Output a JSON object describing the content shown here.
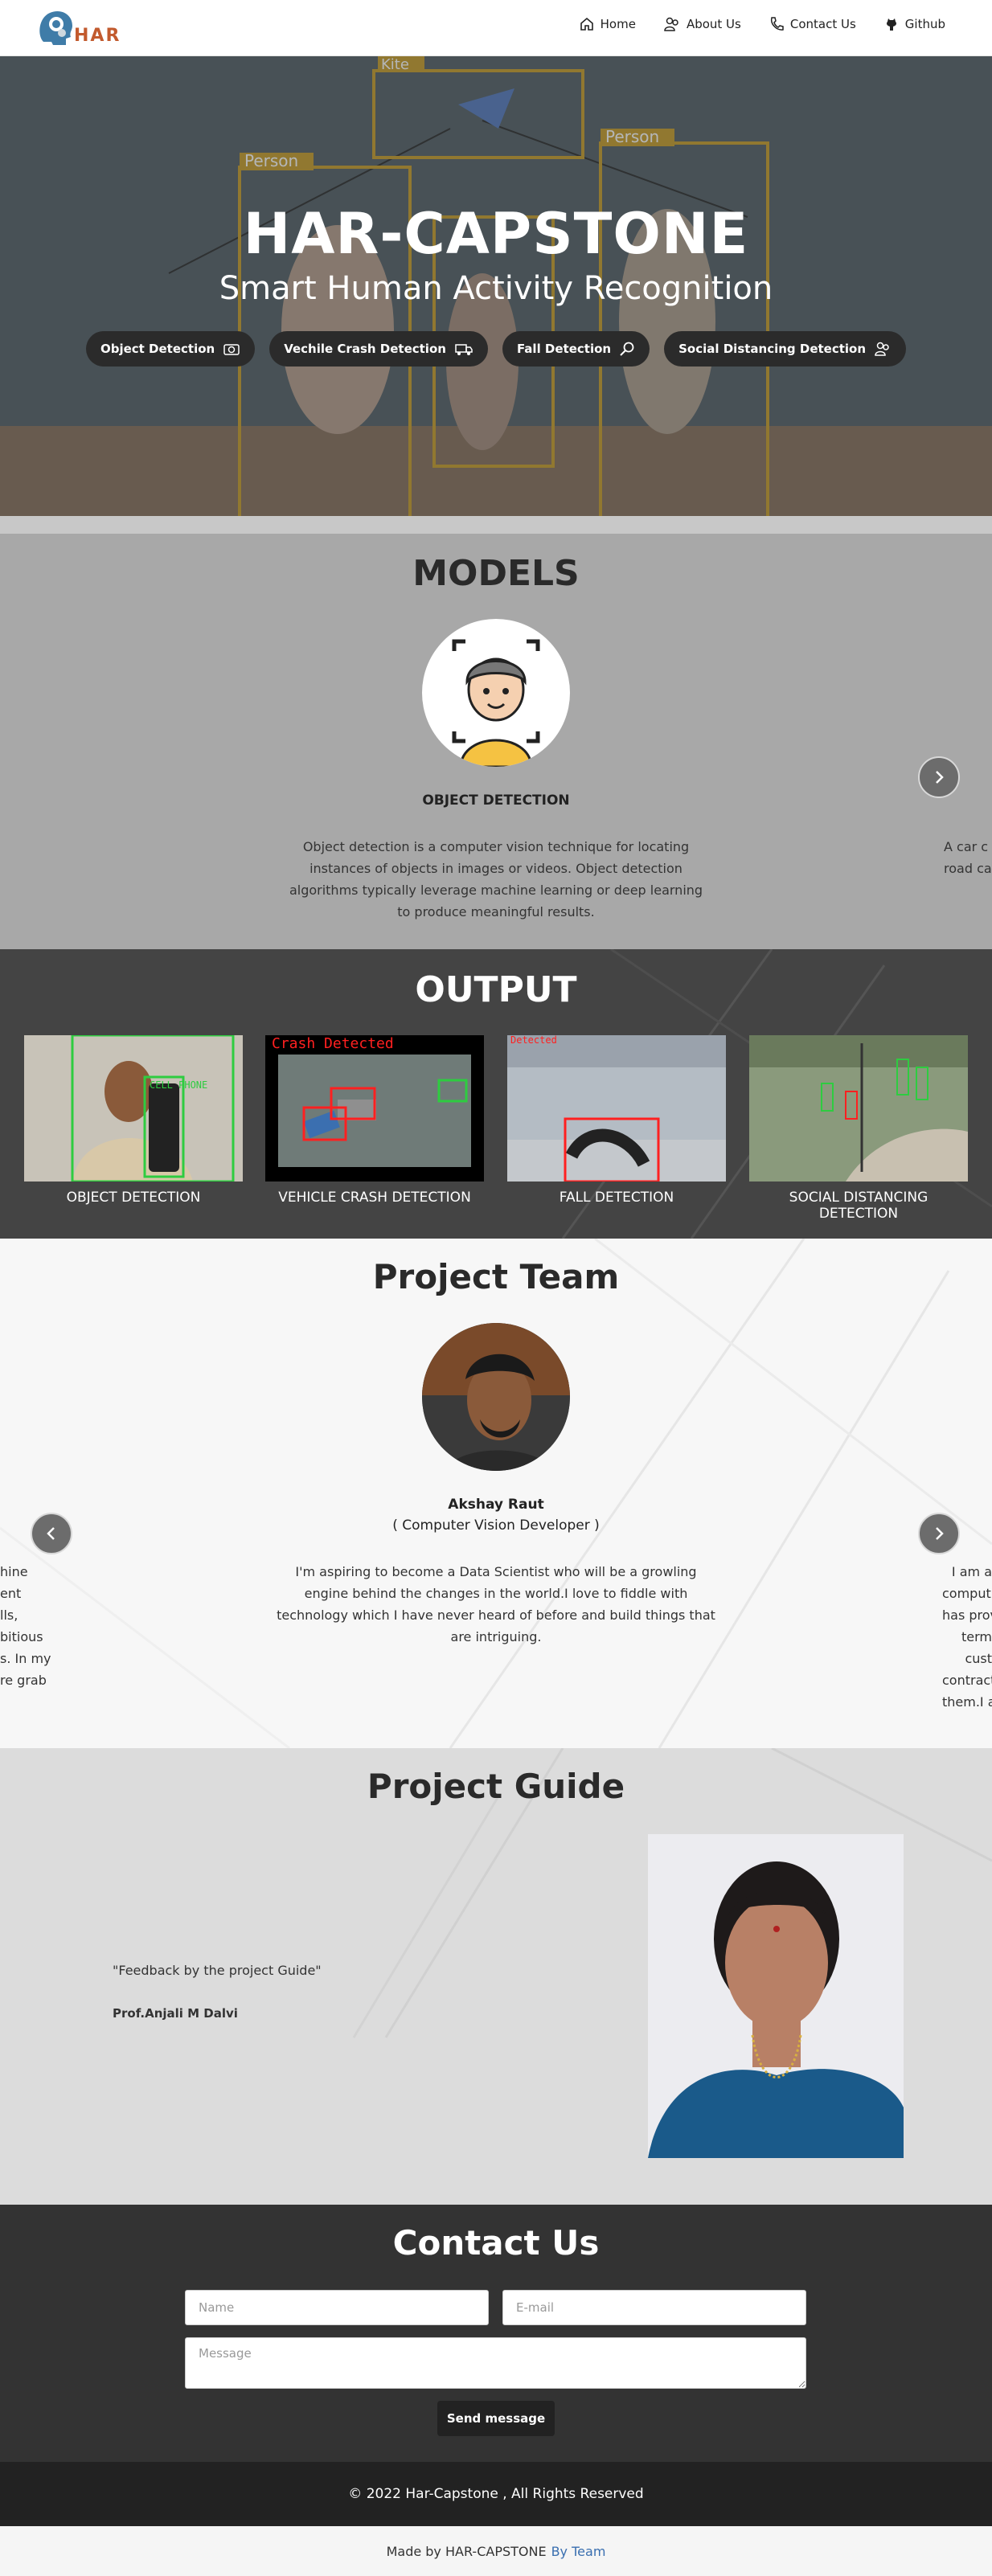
{
  "nav": {
    "logo_text": "HAR",
    "links": [
      {
        "label": "Home",
        "icon": "home-icon"
      },
      {
        "label": "About Us",
        "icon": "users-icon"
      },
      {
        "label": "Contact Us",
        "icon": "phone-icon"
      },
      {
        "label": "Github",
        "icon": "github-icon"
      }
    ]
  },
  "hero": {
    "title": "HAR-CAPSTONE",
    "subtitle": "Smart Human Activity Recognition",
    "box_labels": [
      "Kite",
      "Person",
      "Person"
    ],
    "pills": [
      {
        "label": "Object Detection",
        "icon": "camera-icon"
      },
      {
        "label": "Vechile Crash Detection",
        "icon": "truck-icon"
      },
      {
        "label": "Fall Detection",
        "icon": "search-icon"
      },
      {
        "label": "Social Distancing Detection",
        "icon": "people-icon"
      }
    ]
  },
  "models": {
    "title": "MODELS",
    "current": {
      "name": "OBJECT DETECTION",
      "description": "Object detection is a computer vision technique for locating instances of objects in images or videos. Object detection algorithms typically leverage machine learning or deep learning to produce meaningful results."
    },
    "next_peek": "A car c\nroad ca"
  },
  "output": {
    "title": "OUTPUT",
    "items": [
      {
        "label": "OBJECT DETECTION",
        "overlay": "CELL PHONE"
      },
      {
        "label": "VEHICLE CRASH DETECTION",
        "overlay": "Crash Detected"
      },
      {
        "label": "FALL DETECTION",
        "overlay": "Detected"
      },
      {
        "label": "SOCIAL DISTANCING DETECTION",
        "overlay": ""
      }
    ]
  },
  "team": {
    "title": "Project Team",
    "current": {
      "name": "Akshay Raut",
      "role": "( Computer Vision Developer )",
      "description": "I'm aspiring to become a Data Scientist who will be a growling engine behind the changes in the world.I love to fiddle with technology which I have never heard of before and build things that are intriguing."
    },
    "prev_peek": "hine\nent\nlls,\nbitious\ns. In my\nre grab",
    "next_peek": "I am a\ncomputi\nhas prov\nterm\ncust\ncontract\nthem.I a"
  },
  "guide": {
    "title": "Project Guide",
    "quote": "\"Feedback by the project Guide\"",
    "name": "Prof.Anjali M Dalvi"
  },
  "contact": {
    "title": "Contact Us",
    "name_placeholder": "Name",
    "email_placeholder": "E-mail",
    "message_placeholder": "Message",
    "send_label": "Send message"
  },
  "footer": {
    "copyright": "© 2022 Har-Capstone , All Rights Reserved",
    "made_by": "Made by HAR-CAPSTONE",
    "made_by_link": "By Team"
  }
}
